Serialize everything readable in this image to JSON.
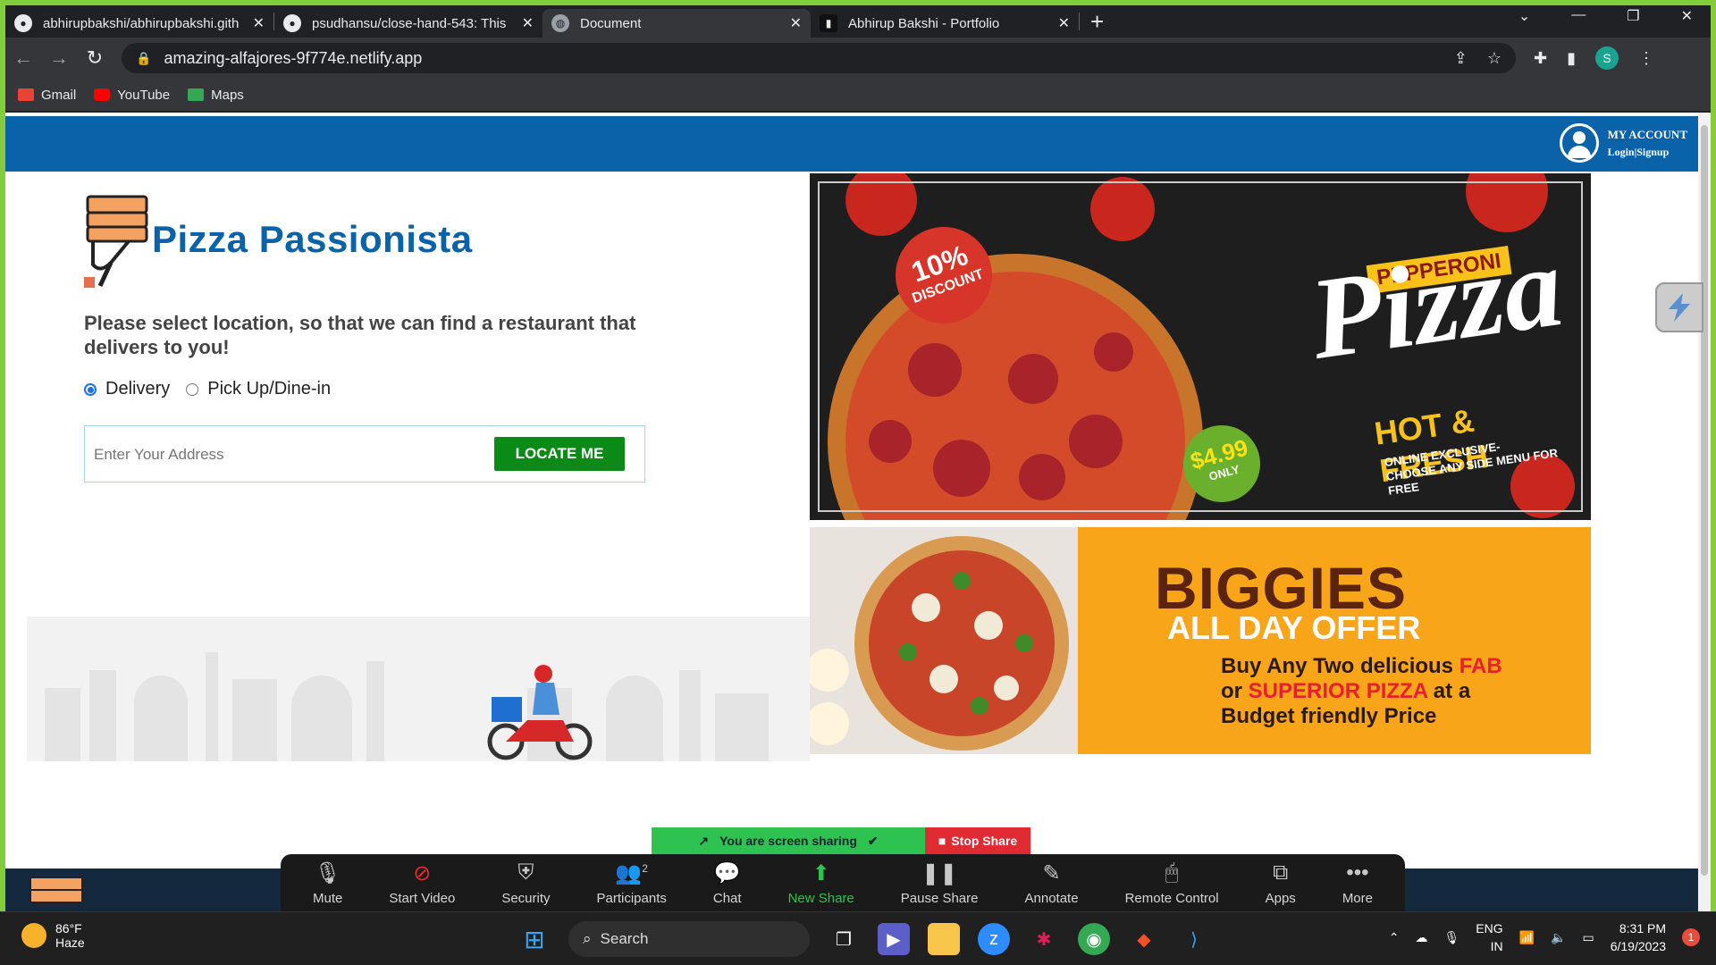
{
  "browser": {
    "tabs": [
      {
        "title": "abhirupbakshi/abhirupbakshi.gith",
        "icon": "github-icon",
        "active": false
      },
      {
        "title": "psudhansu/close-hand-543: This",
        "icon": "github-icon",
        "active": false
      },
      {
        "title": "Document",
        "icon": "globe-icon",
        "active": true
      },
      {
        "title": "Abhirup Bakshi - Portfolio",
        "icon": "folder-icon",
        "active": false
      }
    ],
    "url": "amazing-alfajores-9f774e.netlify.app",
    "profile_initial": "S",
    "bookmarks": [
      {
        "label": "Gmail",
        "color": "#ea4335"
      },
      {
        "label": "YouTube",
        "color": "#ff0000"
      },
      {
        "label": "Maps",
        "color": "#34a853"
      }
    ]
  },
  "site": {
    "header": {
      "account_title": "MY ACCOUNT",
      "account_sub": "Login|Signup",
      "color": "#0a62a8"
    },
    "brand": "Pizza Passionista",
    "prompt": "Please select location, so that we can find a restaurant that delivers to you!",
    "options": {
      "delivery": "Delivery",
      "pickup": "Pick Up/Dine-in",
      "selected": "delivery"
    },
    "address_placeholder": "Enter Your Address",
    "locate_label": "LOCATE ME"
  },
  "banner1": {
    "discount_pct": "10%",
    "discount_word": "DISCOUNT",
    "pepperoni": "PEPPERONI",
    "pizza": "Pizza",
    "hot": "HOT & FRESH",
    "online1": "ONLINE EXCLUSIVE-",
    "online2": "CHOOSE ANY SIDE MENU FOR FREE",
    "price": "$4.99",
    "price_sub": "ONLY"
  },
  "banner2": {
    "title": "BIGGIES",
    "sub": "ALL DAY OFFER",
    "line1_a": "Buy Any Two delicious ",
    "line1_b": "FAB",
    "line2_a": "or ",
    "line2_b": "SUPERIOR PIZZA",
    "line2_c": " at a",
    "line3": "Budget friendly Price"
  },
  "zoom": {
    "sharing": "You are screen sharing",
    "stop": "Stop Share",
    "participants_count": "2",
    "buttons": [
      "Mute",
      "Start Video",
      "Security",
      "Participants",
      "Chat",
      "New Share",
      "Pause Share",
      "Annotate",
      "Remote Control",
      "Apps",
      "More"
    ]
  },
  "taskbar": {
    "temp": "86°F",
    "weather": "Haze",
    "search": "Search",
    "lang1": "ENG",
    "lang2": "IN",
    "time": "8:31 PM",
    "date": "6/19/2023",
    "notif": "1"
  }
}
